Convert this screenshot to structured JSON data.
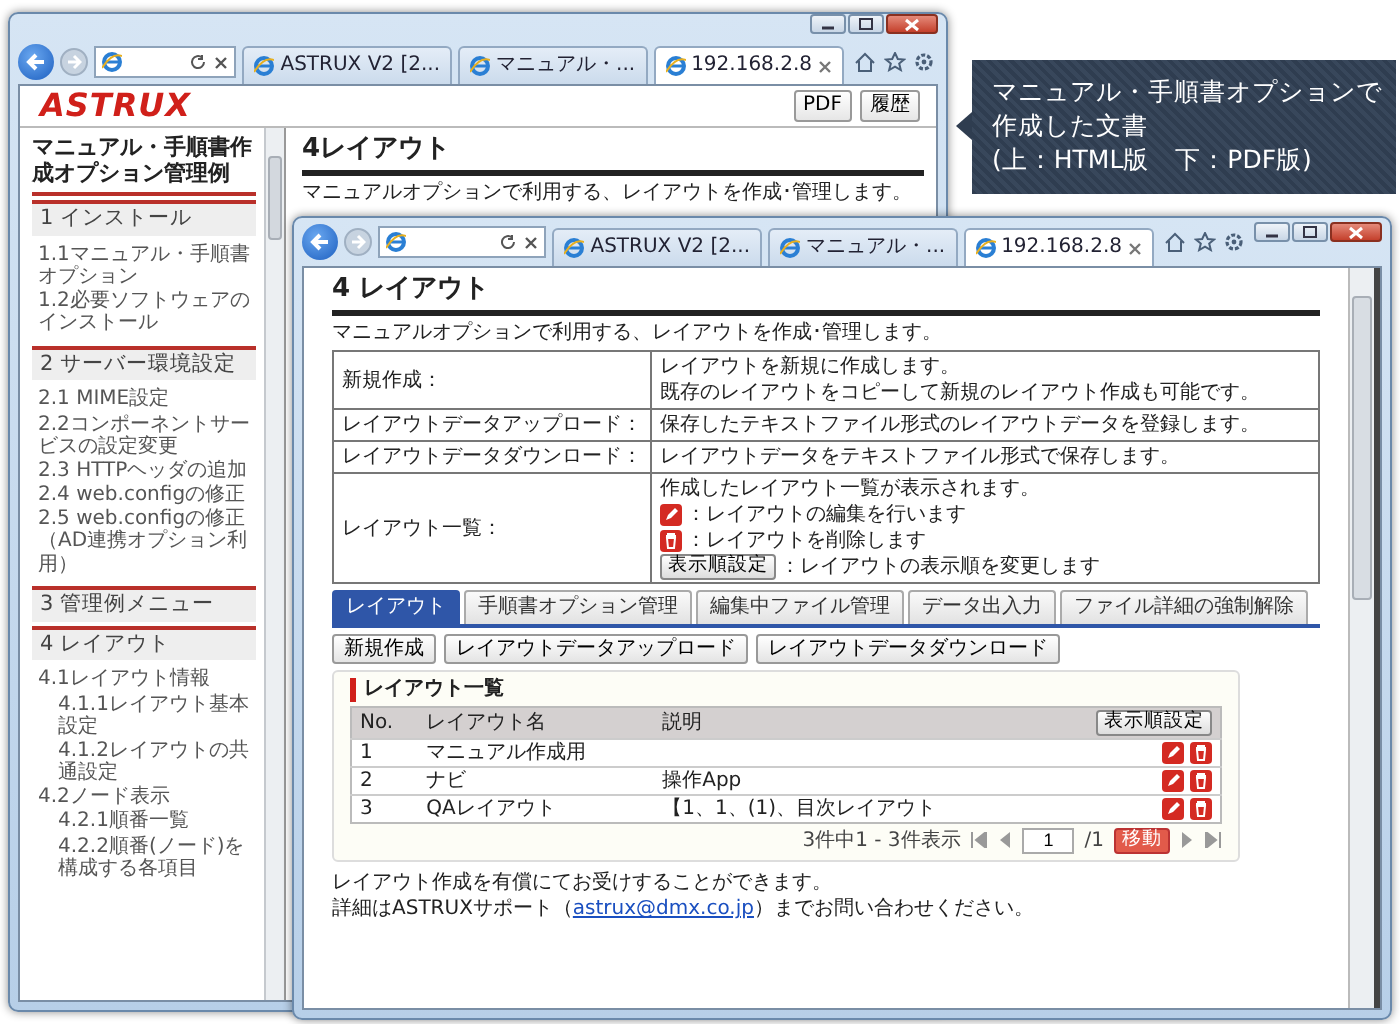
{
  "back_window": {
    "tabs": [
      {
        "label": "ASTRUX V2 [2...",
        "selected": false
      },
      {
        "label": "マニュアル・...",
        "selected": false
      },
      {
        "label": "192.168.2.8",
        "selected": true
      }
    ],
    "logo": "ASTRUX",
    "header_buttons": [
      "PDF",
      "履歴"
    ],
    "sidebar": {
      "title": "マニュアル・手順書作成オプション管理例",
      "sections": [
        {
          "title": "1 インストール",
          "items": [
            {
              "label": "1.1マニュアル・手順書オプション"
            },
            {
              "label": "1.2必要ソフトウェアのインストール"
            }
          ]
        },
        {
          "title": "2 サーバー環境設定",
          "items": [
            {
              "label": "2.1 MIME設定"
            },
            {
              "label": "2.2コンポーネントサービスの設定変更"
            },
            {
              "label": "2.3 HTTPヘッダの追加"
            },
            {
              "label": "2.4 web.configの修正"
            },
            {
              "label": "2.5 web.configの修正（AD連携オプション利用）"
            }
          ]
        },
        {
          "title": "3 管理例メニュー"
        },
        {
          "title": "4 レイアウト",
          "items": [
            {
              "label": "4.1レイアウト情報",
              "children": [
                {
                  "label": "4.1.1レイアウト基本設定"
                },
                {
                  "label": "4.1.2レイアウトの共通設定"
                }
              ]
            },
            {
              "label": "4.2ノード表示",
              "children": [
                {
                  "label": "4.2.1順番一覧"
                },
                {
                  "label": "4.2.2順番(ノード)を構成する各項目"
                }
              ]
            }
          ]
        }
      ]
    },
    "content": {
      "heading": "4レイアウト",
      "intro": "マニュアルオプションで利用する、レイアウトを作成･管理します。"
    }
  },
  "callout": {
    "lines": [
      "マニュアル・手順書オプションで",
      "作成した文書",
      "(上：HTML版　下：PDF版)"
    ]
  },
  "front_window": {
    "tabs": [
      {
        "label": "ASTRUX V2 [2...",
        "selected": false
      },
      {
        "label": "マニュアル・...",
        "selected": false
      },
      {
        "label": "192.168.2.8",
        "selected": true
      }
    ],
    "content": {
      "heading": "4 レイアウト",
      "intro": "マニュアルオプションで利用する、レイアウトを作成･管理します。",
      "definitions": [
        {
          "term": "新規作成：",
          "lines": [
            {
              "kind": "text",
              "text": "レイアウトを新規に作成します。"
            },
            {
              "kind": "text",
              "text": "既存のレイアウトをコピーして新規のレイアウト作成も可能です。"
            }
          ]
        },
        {
          "term": "レイアウトデータアップロード：",
          "lines": [
            {
              "kind": "text",
              "text": "保存したテキストファイル形式のレイアウトデータを登録します。"
            }
          ]
        },
        {
          "term": "レイアウトデータダウンロード：",
          "lines": [
            {
              "kind": "text",
              "text": "レイアウトデータをテキストファイル形式で保存します。"
            }
          ]
        },
        {
          "term": "レイアウト一覧：",
          "lines": [
            {
              "kind": "text",
              "text": "作成したレイアウト一覧が表示されます。"
            },
            {
              "kind": "edit",
              "text": "：レイアウトの編集を行います"
            },
            {
              "kind": "delete",
              "text": "：レイアウトを削除します"
            },
            {
              "kind": "button",
              "button": "表示順設定",
              "text": "：レイアウトの表示順を変更します"
            }
          ]
        }
      ],
      "tabs": [
        {
          "label": "レイアウト",
          "selected": true
        },
        {
          "label": "手順書オプション管理",
          "selected": false
        },
        {
          "label": "編集中ファイル管理",
          "selected": false
        },
        {
          "label": "データ出入力",
          "selected": false
        },
        {
          "label": "ファイル詳細の強制解除",
          "selected": false
        }
      ],
      "buttons": [
        "新規作成",
        "レイアウトデータアップロード",
        "レイアウトデータダウンロード"
      ],
      "panel": {
        "title": "レイアウト一覧",
        "columns": [
          "No.",
          "レイアウト名",
          "説明"
        ],
        "order_button": "表示順設定",
        "rows": [
          {
            "no": "1",
            "name": "マニュアル作成用"
          },
          {
            "no": "2",
            "name": "ナビ",
            "description": "操作App"
          },
          {
            "no": "3",
            "name": "QAレイアウト",
            "description": "【1、1、(1)、目次レイアウト"
          }
        ],
        "pagination": {
          "summary": "3件中1 - 3件表示",
          "page": "1",
          "total": "/1",
          "go": "移動"
        }
      },
      "notes": {
        "line1": "レイアウト作成を有償にてお受けすることができます。",
        "before": "詳細はASTRUXサポート（",
        "link": "astrux@dmx.co.jp",
        "after": "）までお問い合わせください。"
      }
    }
  }
}
